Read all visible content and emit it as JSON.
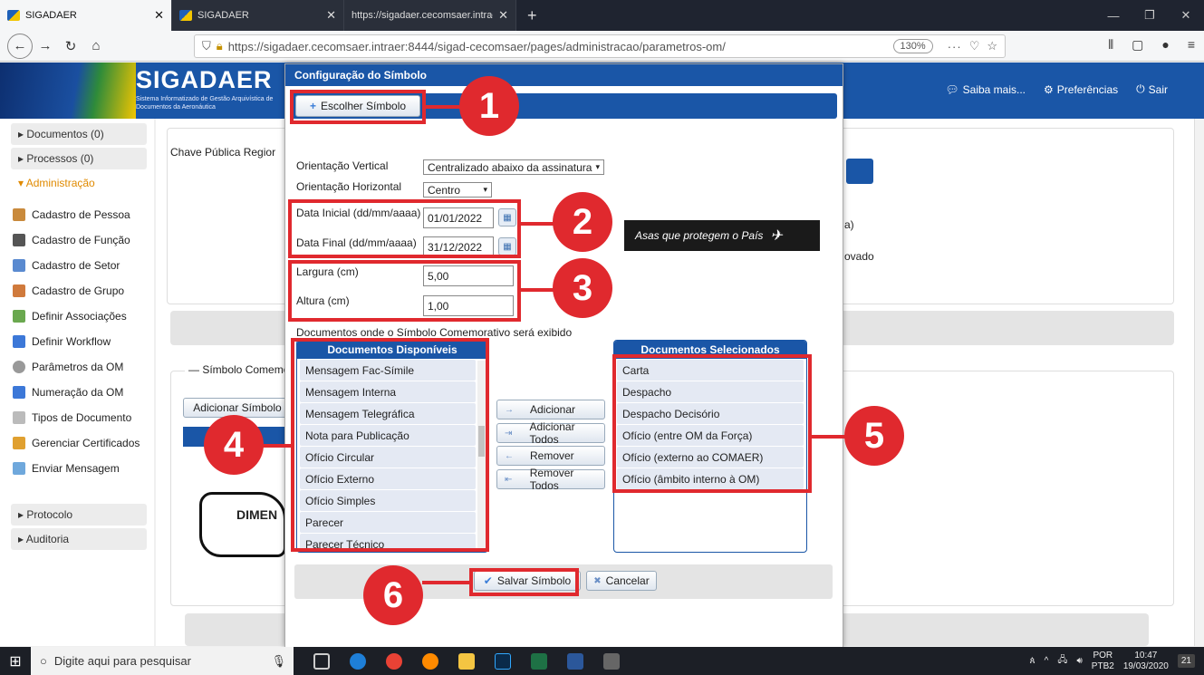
{
  "browser": {
    "tabs": [
      {
        "label": "SIGADAER",
        "active": true
      },
      {
        "label": "SIGADAER",
        "active": false
      },
      {
        "label": "https://sigadaer.cecomsaer.intraer:",
        "active": false
      }
    ],
    "new_tab": "+",
    "url": "https://sigadaer.cecomsaer.intraer:8444/sigad-cecomsaer/pages/administracao/parametros-om/",
    "zoom": "130%",
    "menu_dots": "···"
  },
  "app": {
    "title": "SIGADAER",
    "subtitle": "Sistema Informatizado de Gestão Arquivística de Documentos da Aeronáutica",
    "saiba_mais": "Saiba mais...",
    "preferencias": "Preferências",
    "sair": "Sair"
  },
  "sidebar": {
    "groups_top": [
      {
        "label": "▸ Documentos (0)"
      },
      {
        "label": "▸ Processos (0)"
      },
      {
        "label": "▾ Administração"
      }
    ],
    "items": [
      {
        "label": "Cadastro de Pessoa",
        "color": "#c98a3c"
      },
      {
        "label": "Cadastro de Função",
        "color": "#555555"
      },
      {
        "label": "Cadastro de Setor",
        "color": "#5a8ad0"
      },
      {
        "label": "Cadastro de Grupo",
        "color": "#d07a3c"
      },
      {
        "label": "Definir Associações",
        "color": "#6aa84f"
      },
      {
        "label": "Definir Workflow",
        "color": "#3c78d8"
      },
      {
        "label": "Parâmetros da OM",
        "color": "#999999"
      },
      {
        "label": "Numeração da OM",
        "color": "#3c78d8"
      },
      {
        "label": "Tipos de Documento",
        "color": "#bbbbbb"
      },
      {
        "label": "Gerenciar Certificados",
        "color": "#e0a030"
      },
      {
        "label": "Enviar Mensagem",
        "color": "#6fa8dc"
      }
    ],
    "groups_bottom": [
      {
        "label": "▸ Protocolo"
      },
      {
        "label": "▸ Auditoria"
      }
    ]
  },
  "main": {
    "chave_label": "Chave Pública Regior",
    "simbolo_tab": "— Símbolo Comemo",
    "adicionar_simbolo": "Adicionar Símbolo",
    "side_text_a": "a)",
    "side_text_b": "ovado",
    "logo_text": "DIMEN"
  },
  "dialog": {
    "title": "Configuração do Símbolo",
    "escolher": "Escolher Símbolo",
    "orient_v_label": "Orientação Vertical",
    "orient_v_value": "Centralizado abaixo da assinatura",
    "orient_h_label": "Orientação Horizontal",
    "orient_h_value": "Centro",
    "data_ini_label": "Data Inicial (dd/mm/aaaa)",
    "data_ini_value": "01/01/2022",
    "data_fim_label": "Data Final (dd/mm/aaaa)",
    "data_fim_value": "31/12/2022",
    "largura_label": "Largura (cm)",
    "largura_value": "5,00",
    "altura_label": "Altura (cm)",
    "altura_value": "1,00",
    "slogan": "Asas que protegem o País",
    "docs_caption": "Documentos onde o Símbolo Comemorativo será exibido",
    "disponiveis_title": "Documentos Disponíveis",
    "disponiveis": [
      "Mensagem Fac-Símile",
      "Mensagem Interna",
      "Mensagem Telegráfica",
      "Nota para Publicação",
      "Ofício Circular",
      "Ofício Externo",
      "Ofício Simples",
      "Parecer",
      "Parecer Técnico"
    ],
    "selecionados_title": "Documentos Selecionados",
    "selecionados": [
      "Carta",
      "Despacho",
      "Despacho Decisório",
      "Ofício (entre OM da Força)",
      "Ofício (externo ao COMAER)",
      "Ofício (âmbito interno à OM)"
    ],
    "adicionar": "Adicionar",
    "adicionar_todos": "Adicionar Todos",
    "remover": "Remover",
    "remover_todos": "Remover Todos",
    "salvar": "Salvar Símbolo",
    "cancelar": "Cancelar"
  },
  "callouts": [
    "1",
    "2",
    "3",
    "4",
    "5",
    "6"
  ],
  "taskbar": {
    "search": "Digite aqui para pesquisar",
    "lang": "POR",
    "layout": "PTB2",
    "time": "10:47",
    "date": "19/03/2020",
    "notif": "21"
  },
  "colors": {
    "accent": "#1a56a7",
    "callout": "#e0292e"
  }
}
